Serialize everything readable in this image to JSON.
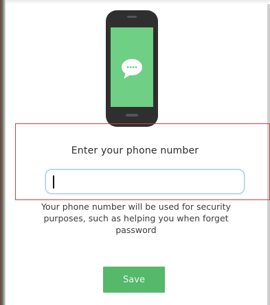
{
  "dialog": {
    "illustration": "phone-with-chat-bubble-icon",
    "prompt": "Enter your phone number",
    "phone_input": {
      "value": "",
      "placeholder": ""
    },
    "help_text": "Your phone number will be used for security purposes, such as helping you when forget password",
    "save_label": "Save"
  },
  "colors": {
    "phone_body": "#2f2f2f",
    "phone_screen": "#6fcf84",
    "accent_green": "#55b86a",
    "highlight_border": "#d93b3b",
    "input_border": "#9cc4dd"
  }
}
